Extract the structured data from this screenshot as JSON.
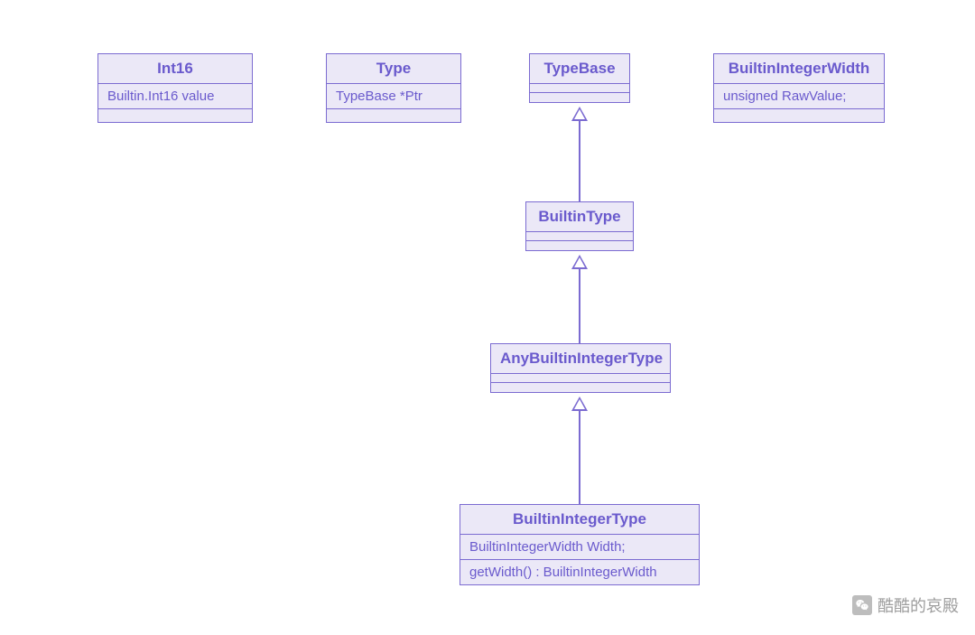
{
  "classes": {
    "int16": {
      "title": "Int16",
      "attr": "Builtin.Int16 value"
    },
    "type": {
      "title": "Type",
      "attr": "TypeBase *Ptr"
    },
    "typebase": {
      "title": "TypeBase"
    },
    "builtinintegerwidth": {
      "title": "BuiltinIntegerWidth",
      "attr": "unsigned RawValue;"
    },
    "builtintype": {
      "title": "BuiltinType"
    },
    "anybuiltinintegertype": {
      "title": "AnyBuiltinIntegerType"
    },
    "builtinintegertype": {
      "title": "BuiltinIntegerType",
      "attr": "BuiltinIntegerWidth Width;",
      "op": "getWidth() : BuiltinIntegerWidth"
    }
  },
  "watermark": {
    "text": "酷酷的哀殿"
  },
  "colors": {
    "border": "#7b6bd1",
    "fill": "#ebe8f7",
    "text": "#6a5acd"
  },
  "relationships": [
    {
      "child": "BuiltinType",
      "parent": "TypeBase",
      "type": "inheritance"
    },
    {
      "child": "AnyBuiltinIntegerType",
      "parent": "BuiltinType",
      "type": "inheritance"
    },
    {
      "child": "BuiltinIntegerType",
      "parent": "AnyBuiltinIntegerType",
      "type": "inheritance"
    }
  ]
}
